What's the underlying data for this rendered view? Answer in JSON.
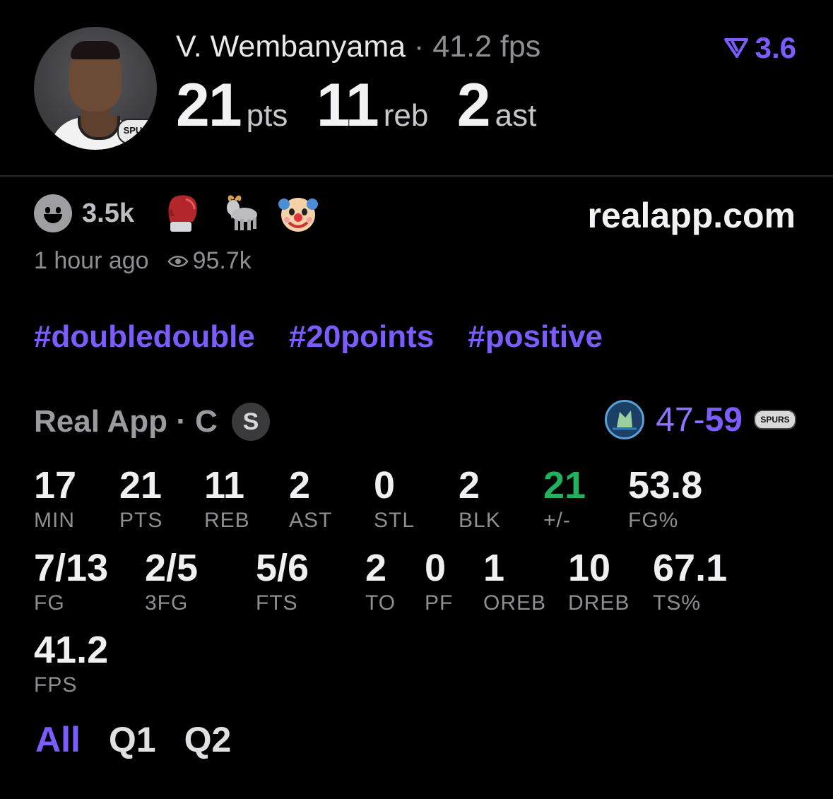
{
  "header": {
    "player_name": "V. Wembanyama",
    "separator": "·",
    "fps_text": "41.2 fps",
    "fps_badge": "3.6",
    "jersey_badge": "SPURS",
    "pts": "21",
    "pts_unit": "pts",
    "reb": "11",
    "reb_unit": "reb",
    "ast": "2",
    "ast_unit": "ast"
  },
  "reactions": {
    "count": "3.5k",
    "emojis": [
      "boxing-glove-icon",
      "goat-icon",
      "clown-icon"
    ]
  },
  "site": "realapp.com",
  "meta": {
    "time": "1 hour ago",
    "views": "95.7k"
  },
  "tags": [
    "#doubledouble",
    "#20points",
    "#positive"
  ],
  "game": {
    "league": "Real App · C",
    "position_badge": "S",
    "away_score": "47",
    "dash": "-",
    "home_score": "59",
    "home_badge": "SPURS"
  },
  "stats_row1": [
    {
      "value": "17",
      "label": "MIN"
    },
    {
      "value": "21",
      "label": "PTS"
    },
    {
      "value": "11",
      "label": "REB"
    },
    {
      "value": "2",
      "label": "AST"
    },
    {
      "value": "0",
      "label": "STL"
    },
    {
      "value": "2",
      "label": "BLK"
    },
    {
      "value": "21",
      "label": "+/-"
    },
    {
      "value": "53.8",
      "label": "FG%"
    }
  ],
  "stats_row2": [
    {
      "value": "7/13",
      "label": "FG"
    },
    {
      "value": "2/5",
      "label": "3FG"
    },
    {
      "value": "5/6",
      "label": "FTS"
    },
    {
      "value": "2",
      "label": "TO"
    },
    {
      "value": "0",
      "label": "PF"
    },
    {
      "value": "1",
      "label": "OREB"
    },
    {
      "value": "10",
      "label": "DREB"
    },
    {
      "value": "67.1",
      "label": "TS%"
    }
  ],
  "stats_row3": [
    {
      "value": "41.2",
      "label": "FPS"
    }
  ],
  "quarters": [
    "All",
    "Q1",
    "Q2"
  ],
  "colors": {
    "accent": "#7c5cff",
    "positive": "#1fb35f",
    "background": "#000000"
  }
}
